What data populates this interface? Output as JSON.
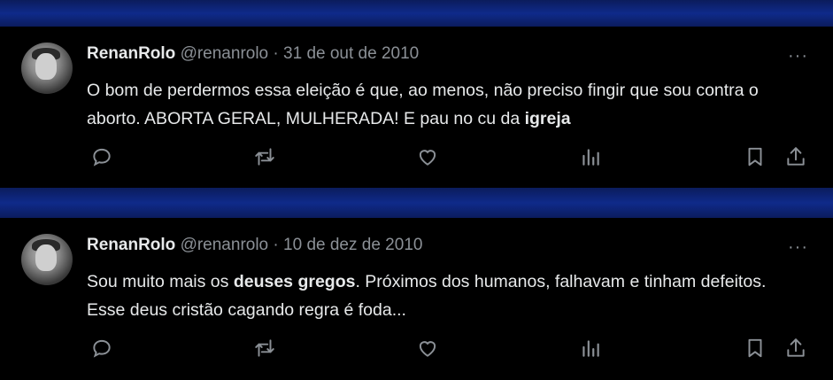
{
  "tweets": [
    {
      "name": "RenanRolo",
      "handle": "@renanrolo",
      "sep": "·",
      "date": "31 de out de 2010",
      "more": "···",
      "text": {
        "part1": "O bom de perdermos essa eleição é que, ao menos, não preciso fingir que sou contra o aborto. ABORTA GERAL, MULHERADA! E pau no cu da ",
        "bold1": "igreja",
        "part2": ""
      }
    },
    {
      "name": "RenanRolo",
      "handle": "@renanrolo",
      "sep": "·",
      "date": "10 de dez de 2010",
      "more": "···",
      "text": {
        "part1": "Sou muito mais os ",
        "bold1": "deuses gregos",
        "part2": ". Próximos dos humanos, falhavam e tinham defeitos. Esse deus cristão cagando regra é foda..."
      }
    }
  ],
  "icons": {
    "reply": "reply-icon",
    "retweet": "retweet-icon",
    "like": "like-icon",
    "views": "views-icon",
    "bookmark": "bookmark-icon",
    "share": "share-icon"
  },
  "colors": {
    "background_band": "#0f2a8a",
    "tweet_bg": "#000000",
    "text": "#e7e9ea",
    "muted": "#8b9096"
  }
}
